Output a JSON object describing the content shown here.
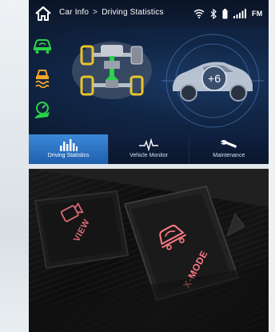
{
  "screen": {
    "breadcrumb": {
      "parent": "Car Info",
      "separator": ">",
      "current": "Driving Statistics"
    },
    "status": {
      "radio_band": "FM"
    },
    "gauge_value": "+6",
    "tabs": [
      {
        "label": "Driving Statistics",
        "icon": "bar-graph-icon",
        "active": true
      },
      {
        "label": "Vehicle Monitor",
        "icon": "pulse-icon",
        "active": false
      },
      {
        "label": "Maintenance",
        "icon": "wrench-icon",
        "active": false
      }
    ],
    "side_icons": [
      "vehicle-status-icon",
      "stability-warning-icon",
      "eco-status-icon"
    ]
  },
  "panel": {
    "view_button_label": "VIEW",
    "xmode_button_label": "X-MODE"
  },
  "colors": {
    "screen_bg": "#0d1a30",
    "active_tab": "#2f7ed0",
    "icon_green": "#2bd24a",
    "icon_orange": "#f3a629",
    "drivetrain_yellow": "#e8c52c",
    "xmode_glow": "#ff7a85",
    "view_label": "#d86b74"
  }
}
